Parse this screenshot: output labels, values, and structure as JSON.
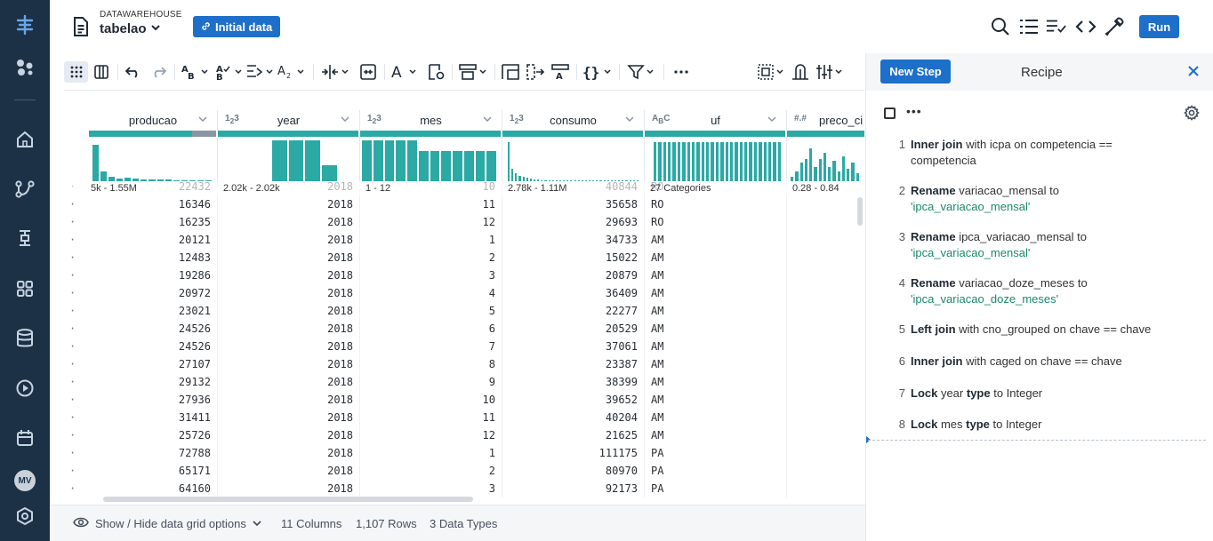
{
  "header": {
    "datasource_label": "DATAWAREHOUSE",
    "dataset_name": "tabelao",
    "badge_label": "Initial data",
    "run_label": "Run"
  },
  "sidebar": {
    "avatar_initials": "MV",
    "icons": [
      "logo-icon",
      "flows-icon",
      "home-icon",
      "transform-icon",
      "jobs-icon",
      "library-icon",
      "database-icon",
      "play-icon",
      "schedule-icon",
      "settings-icon"
    ]
  },
  "grid": {
    "columns": [
      {
        "name": "producao",
        "type": "",
        "range": "5k - 1.55M"
      },
      {
        "name": "year",
        "type": "1 2 3",
        "range": "2.02k - 2.02k"
      },
      {
        "name": "mes",
        "type": "1 2 3",
        "range": "1 - 12"
      },
      {
        "name": "consumo",
        "type": "1 2 3",
        "range": "2.78k - 1.11M"
      },
      {
        "name": "uf",
        "type": "A B C",
        "range": "27 Categories"
      },
      {
        "name": "preco_ci",
        "type": "#.#",
        "range": "0.28 - 0.84"
      }
    ],
    "histograms": {
      "producao": [
        0.9,
        0.25,
        0.1,
        0.06,
        0.08,
        0.06,
        0.05,
        0.05,
        0.04,
        0.04,
        0.03,
        0.03,
        0.03,
        0.02,
        0.02
      ],
      "year": [
        0,
        0,
        0,
        1,
        1,
        1,
        0.4,
        0
      ],
      "mes": [
        1,
        1,
        1,
        1,
        1,
        0.75,
        0.75,
        0.75,
        0.75,
        0.75,
        0.75,
        0.75
      ],
      "consumo": [
        0.95,
        0.3,
        0.2,
        0.12,
        0.1,
        0.08,
        0.06,
        0.05,
        0.04,
        0.03,
        0.03,
        0.02,
        0.02,
        0.02,
        0.02,
        0.02,
        0.02,
        0.02,
        0.02,
        0.02,
        0.02,
        0.02,
        0.02,
        0.02,
        0.02,
        0.02,
        0.02,
        0.02,
        0.02,
        0.02,
        0.02,
        0.02,
        0.02,
        0.02,
        0.02,
        0.02
      ],
      "uf": [
        0.95,
        0.95,
        0.95,
        0.95,
        0.95,
        0.95,
        0.95,
        0.95,
        0.95,
        0.95,
        0.95,
        0.95,
        0.95,
        0.95,
        0.95,
        0.95,
        0.95,
        0.95,
        0.95,
        0.95,
        0.95,
        0.95,
        0.95,
        0.95,
        0.95,
        0.95,
        0.95
      ],
      "preco_ci": [
        0.1,
        0.25,
        0.45,
        0.55,
        0.8,
        0.35,
        0.55,
        0.7,
        0.35,
        0.5,
        0.25,
        0.6,
        0.3,
        0.45,
        0.2
      ]
    },
    "rows": [
      [
        "22432",
        "2018",
        "10",
        "40844",
        "RO"
      ],
      [
        "16346",
        "2018",
        "11",
        "35658",
        "RO"
      ],
      [
        "16235",
        "2018",
        "12",
        "29693",
        "RO"
      ],
      [
        "20121",
        "2018",
        "1",
        "34733",
        "AM"
      ],
      [
        "12483",
        "2018",
        "2",
        "15022",
        "AM"
      ],
      [
        "19286",
        "2018",
        "3",
        "20879",
        "AM"
      ],
      [
        "20972",
        "2018",
        "4",
        "36409",
        "AM"
      ],
      [
        "23021",
        "2018",
        "5",
        "22277",
        "AM"
      ],
      [
        "24526",
        "2018",
        "6",
        "20529",
        "AM"
      ],
      [
        "24526",
        "2018",
        "7",
        "37061",
        "AM"
      ],
      [
        "27107",
        "2018",
        "8",
        "23387",
        "AM"
      ],
      [
        "29132",
        "2018",
        "9",
        "38399",
        "AM"
      ],
      [
        "27936",
        "2018",
        "10",
        "39652",
        "AM"
      ],
      [
        "31411",
        "2018",
        "11",
        "40204",
        "AM"
      ],
      [
        "25726",
        "2018",
        "12",
        "21625",
        "AM"
      ],
      [
        "72788",
        "2018",
        "1",
        "111175",
        "PA"
      ],
      [
        "65171",
        "2018",
        "2",
        "80970",
        "PA"
      ],
      [
        "64160",
        "2018",
        "3",
        "92173",
        "PA"
      ]
    ]
  },
  "footer": {
    "grid_options_label": "Show / Hide data grid options",
    "columns_count": "11 Columns",
    "rows_count": "1,107 Rows",
    "types_count": "3 Data Types"
  },
  "recipe": {
    "new_step_label": "New Step",
    "title": "Recipe",
    "steps": [
      {
        "num": "1",
        "parts": [
          {
            "t": "Inner join",
            "b": true
          },
          {
            "t": " with icpa on competencia == competencia"
          }
        ]
      },
      {
        "num": "2",
        "parts": [
          {
            "t": "Rename",
            "b": true
          },
          {
            "t": " variacao_mensal to "
          },
          {
            "t": "'ipca_variacao_mensal'",
            "g": true
          }
        ]
      },
      {
        "num": "3",
        "parts": [
          {
            "t": "Rename",
            "b": true
          },
          {
            "t": " ipca_variacao_mensal to "
          },
          {
            "t": "'ipca_variacao_mensal'",
            "g": true
          }
        ]
      },
      {
        "num": "4",
        "parts": [
          {
            "t": "Rename",
            "b": true
          },
          {
            "t": " variacao_doze_meses to "
          },
          {
            "t": "'ipca_variacao_doze_meses'",
            "g": true
          }
        ]
      },
      {
        "num": "5",
        "parts": [
          {
            "t": "Left join",
            "b": true
          },
          {
            "t": " with cno_grouped on chave == chave"
          }
        ]
      },
      {
        "num": "6",
        "parts": [
          {
            "t": "Inner join",
            "b": true
          },
          {
            "t": " with caged on chave == chave"
          }
        ]
      },
      {
        "num": "7",
        "parts": [
          {
            "t": "Lock",
            "b": true
          },
          {
            "t": " year "
          },
          {
            "t": "type",
            "b": true
          },
          {
            "t": " to Integer"
          }
        ]
      },
      {
        "num": "8",
        "parts": [
          {
            "t": "Lock",
            "b": true
          },
          {
            "t": " mes "
          },
          {
            "t": "type",
            "b": true
          },
          {
            "t": " to Integer"
          }
        ]
      }
    ]
  },
  "colors": {
    "sidebar": "#1c3046",
    "accent": "#1d6fc9",
    "histogram": "#2ba9a4",
    "recipe_value": "#1a8a6a"
  }
}
